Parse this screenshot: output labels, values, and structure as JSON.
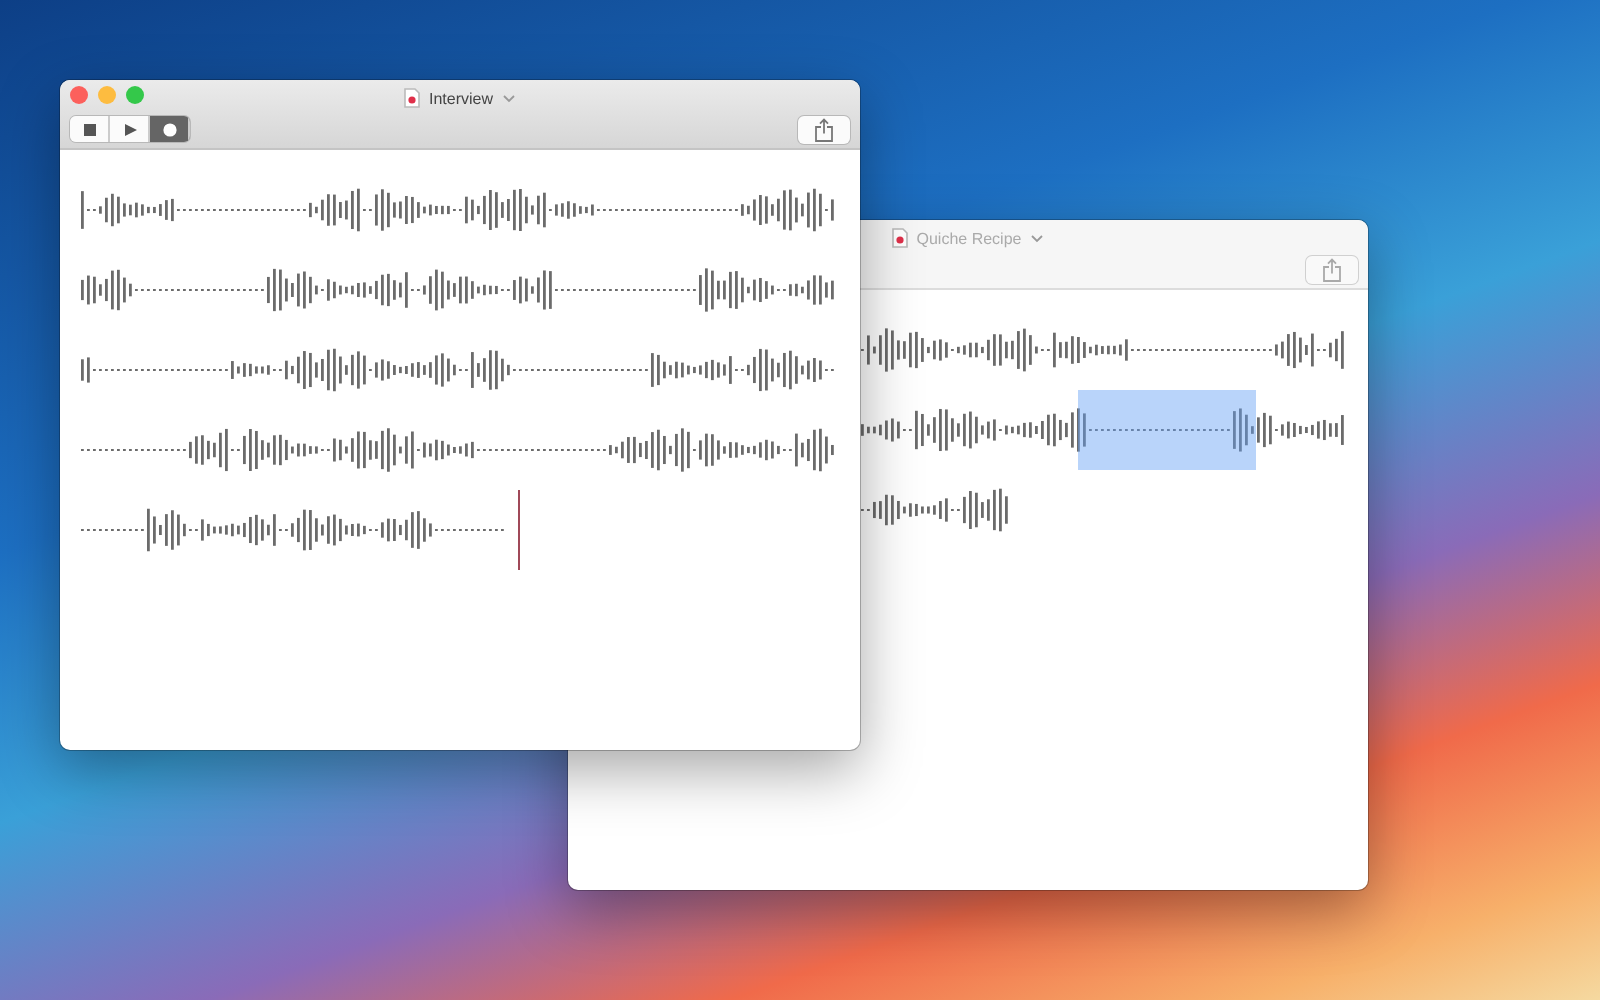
{
  "windows": [
    {
      "title": "Interview",
      "active": true,
      "transport": [
        {
          "kind": "stop",
          "selected": false
        },
        {
          "kind": "play",
          "selected": false
        },
        {
          "kind": "record",
          "selected": true
        }
      ]
    },
    {
      "title": "Quiche Recipe",
      "active": false
    }
  ]
}
